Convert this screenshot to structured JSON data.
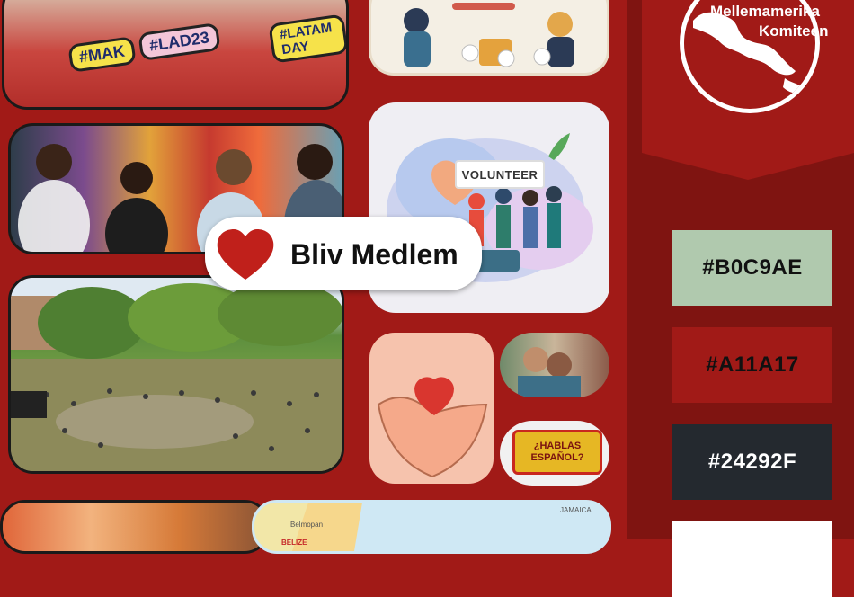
{
  "logo": {
    "line1": "Mellemamerika",
    "line2": "Komiteen"
  },
  "cta": {
    "label": "Bliv Medlem"
  },
  "palette": [
    {
      "hex": "#B0C9AE"
    },
    {
      "hex": "#A11A17"
    },
    {
      "hex": "#24292F"
    },
    {
      "hex": ""
    }
  ],
  "photos": {
    "crowd_signs": [
      "#MAK",
      "#LAD23",
      "#LATAM DAY"
    ],
    "volunteer_banner": "VOLUNTEER",
    "hablas": {
      "line1": "¿HABLAS",
      "line2": "ESPAÑOL?"
    },
    "map_labels": [
      "Belmopan",
      "BELIZE",
      "JAMAICA"
    ]
  },
  "colors": {
    "background": "#A11A17",
    "sidebar": "#7f1411",
    "heart": "#c0201b"
  }
}
